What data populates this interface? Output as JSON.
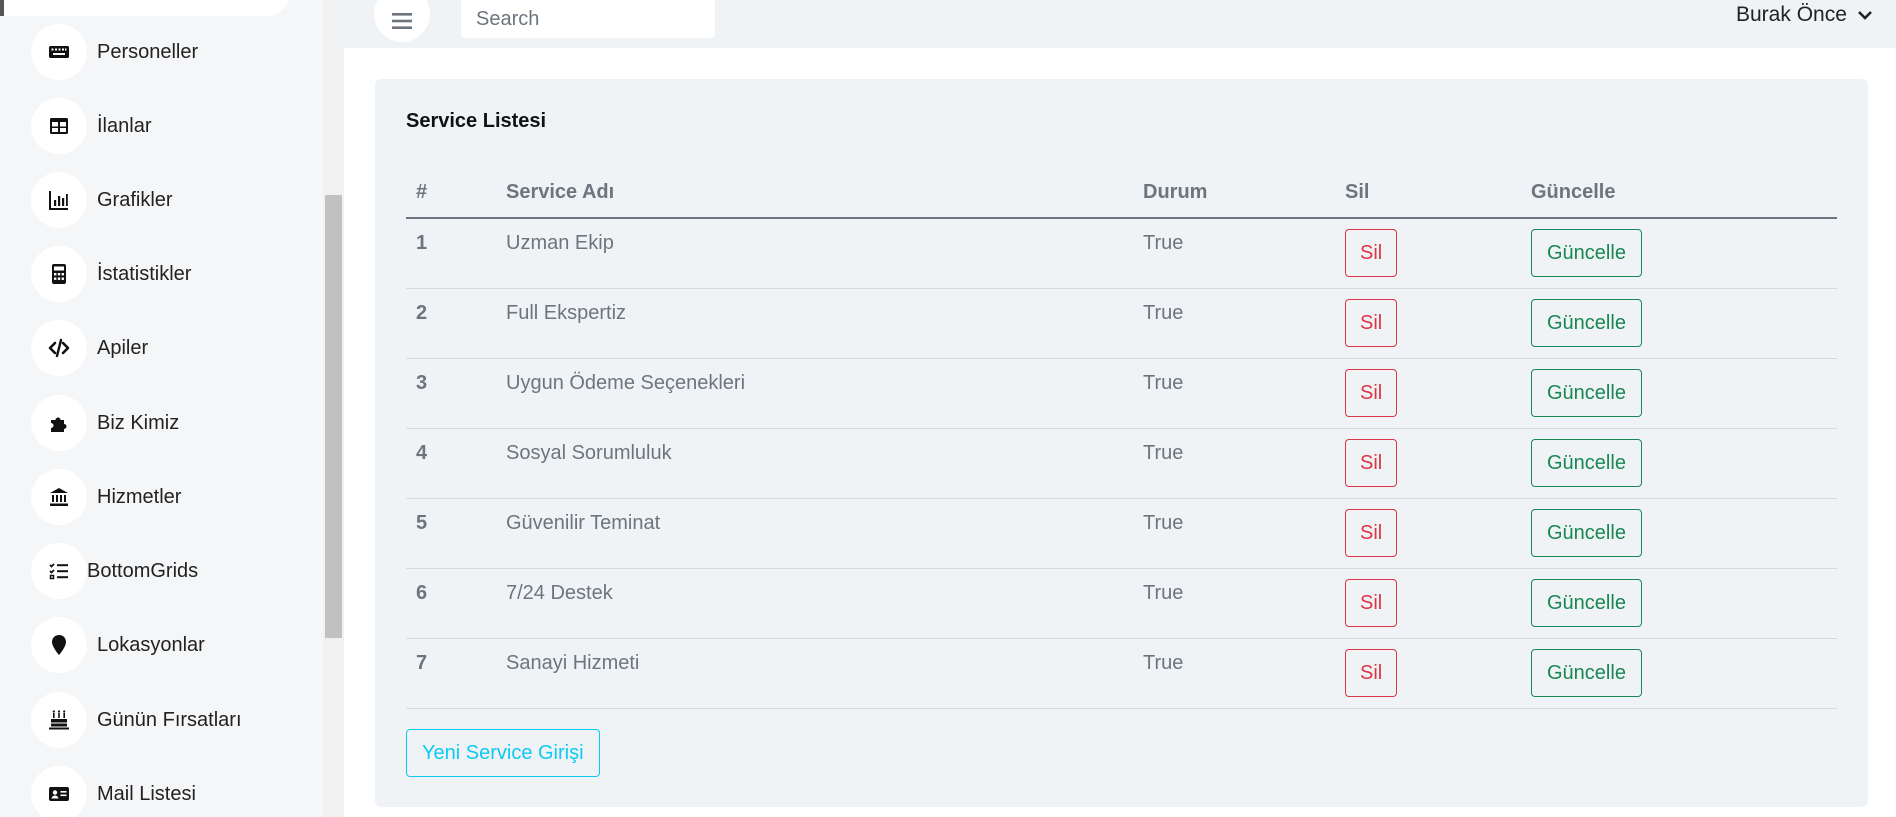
{
  "sidebar": {
    "items": [
      {
        "label": "Personeller",
        "icon": "keyboard-icon"
      },
      {
        "label": "İlanlar",
        "icon": "table-icon"
      },
      {
        "label": "Grafikler",
        "icon": "bar-chart-icon"
      },
      {
        "label": "İstatistikler",
        "icon": "calculator-icon"
      },
      {
        "label": "Apiler",
        "icon": "code-icon"
      },
      {
        "label": "Biz Kimiz",
        "icon": "puzzle-icon"
      },
      {
        "label": "Hizmetler",
        "icon": "bank-icon"
      },
      {
        "label": "BottomGrids",
        "icon": "list-check-icon"
      },
      {
        "label": "Lokasyonlar",
        "icon": "map-pin-icon"
      },
      {
        "label": "Günün Fırsatları",
        "icon": "cake-icon"
      },
      {
        "label": "Mail Listesi",
        "icon": "id-card-icon"
      }
    ]
  },
  "header": {
    "search_placeholder": "Search",
    "user_name": "Burak Önce"
  },
  "main": {
    "card_title": "Service Listesi",
    "columns": [
      "#",
      "Service Adı",
      "Durum",
      "Sil",
      "Güncelle"
    ],
    "rows": [
      {
        "num": "1",
        "name": "Uzman Ekip",
        "durum": "True",
        "sil": "Sil",
        "guncelle": "Güncelle"
      },
      {
        "num": "2",
        "name": "Full Ekspertiz",
        "durum": "True",
        "sil": "Sil",
        "guncelle": "Güncelle"
      },
      {
        "num": "3",
        "name": "Uygun Ödeme Seçenekleri",
        "durum": "True",
        "sil": "Sil",
        "guncelle": "Güncelle"
      },
      {
        "num": "4",
        "name": "Sosyal Sorumluluk",
        "durum": "True",
        "sil": "Sil",
        "guncelle": "Güncelle"
      },
      {
        "num": "5",
        "name": "Güvenilir Teminat",
        "durum": "True",
        "sil": "Sil",
        "guncelle": "Güncelle"
      },
      {
        "num": "6",
        "name": "7/24 Destek",
        "durum": "True",
        "sil": "Sil",
        "guncelle": "Güncelle"
      },
      {
        "num": "7",
        "name": "Sanayi Hizmeti",
        "durum": "True",
        "sil": "Sil",
        "guncelle": "Güncelle"
      }
    ],
    "new_button_label": "Yeni Service Girişi"
  },
  "colors": {
    "danger": "#dc3545",
    "success": "#198754",
    "info": "#0dcaf0"
  }
}
